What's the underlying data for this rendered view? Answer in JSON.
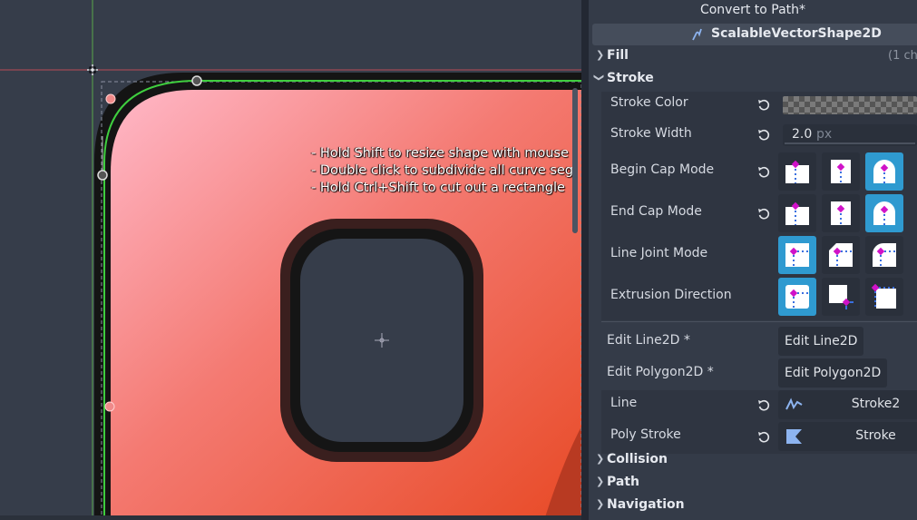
{
  "viewport": {
    "hint_lines": [
      "- Hold Shift to resize shape with mouse",
      "- Double click to subdivide all curve seg",
      "- Hold Ctrl+Shift to cut out a rectangle"
    ],
    "colors": {
      "background": "#363d4a",
      "gradient_start": "#ffb8c8",
      "gradient_end": "#e8502e",
      "outline": "#1a1a1a",
      "curve": "#3fce3f"
    }
  },
  "inspector": {
    "top_button": "Convert to Path*",
    "node_name": "ScalableVectorShape2D",
    "sections": {
      "fill": {
        "label": "Fill",
        "count": "(1 ch"
      },
      "stroke": {
        "label": "Stroke"
      },
      "collision": {
        "label": "Collision"
      },
      "path": {
        "label": "Path"
      },
      "navigation": {
        "label": "Navigation"
      }
    },
    "stroke_props": {
      "stroke_color": "Stroke Color",
      "stroke_width": "Stroke Width",
      "stroke_width_value": "2.0",
      "stroke_width_unit": "px",
      "begin_cap_mode": "Begin Cap Mode",
      "end_cap_mode": "End Cap Mode",
      "line_joint_mode": "Line Joint Mode",
      "extrusion_direction": "Extrusion Direction"
    },
    "edit_line2d_label": "Edit Line2D *",
    "edit_line2d_button": "Edit Line2D",
    "edit_polygon2d_label": "Edit Polygon2D *",
    "edit_polygon2d_button": "Edit Polygon2D",
    "line_label": "Line",
    "line_value": "Stroke2",
    "poly_stroke_label": "Poly Stroke",
    "poly_stroke_value": "Stroke",
    "accent_color": "#2f9ad0"
  }
}
